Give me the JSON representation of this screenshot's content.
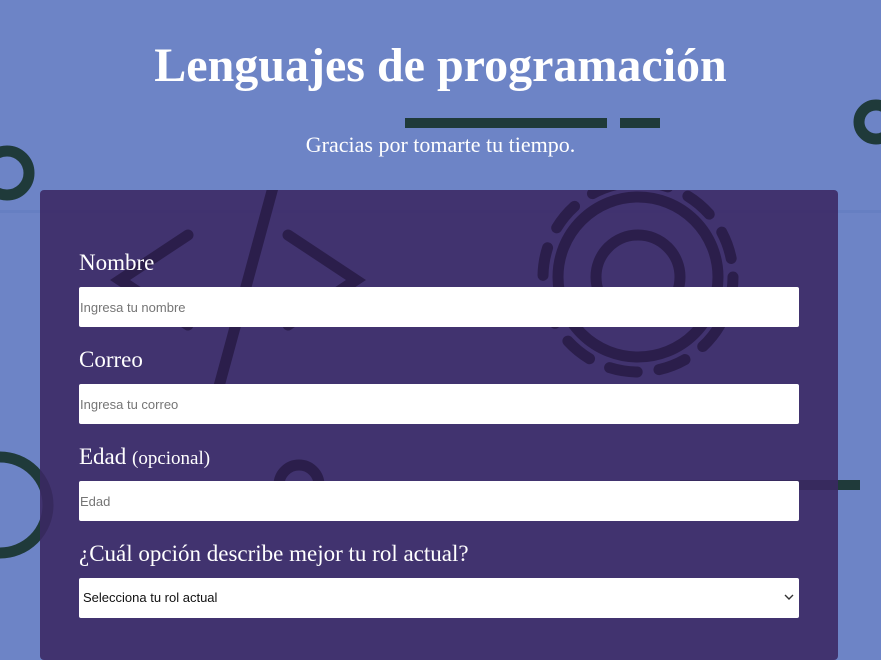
{
  "header": {
    "title": "Lenguajes de programación",
    "subtitle": "Gracias por tomarte tu tiempo."
  },
  "form": {
    "name": {
      "label": "Nombre",
      "placeholder": "Ingresa tu nombre",
      "value": ""
    },
    "email": {
      "label": "Correo",
      "placeholder": "Ingresa tu correo",
      "value": ""
    },
    "age": {
      "label": "Edad",
      "label_hint": "(opcional)",
      "placeholder": "Edad",
      "value": ""
    },
    "role": {
      "label": "¿Cuál opción describe mejor tu rol actual?",
      "selected": "Selecciona tu rol actual"
    }
  },
  "icons": {
    "background": [
      "code-brackets-icon",
      "gear-icon",
      "circle-icon",
      "dash-line-icon"
    ],
    "select": "chevron-down-icon"
  },
  "colors": {
    "page_background": "#6d84c6",
    "card_background": "#3b2863",
    "text": "#ffffff",
    "decoration": "#1f2a3a"
  }
}
